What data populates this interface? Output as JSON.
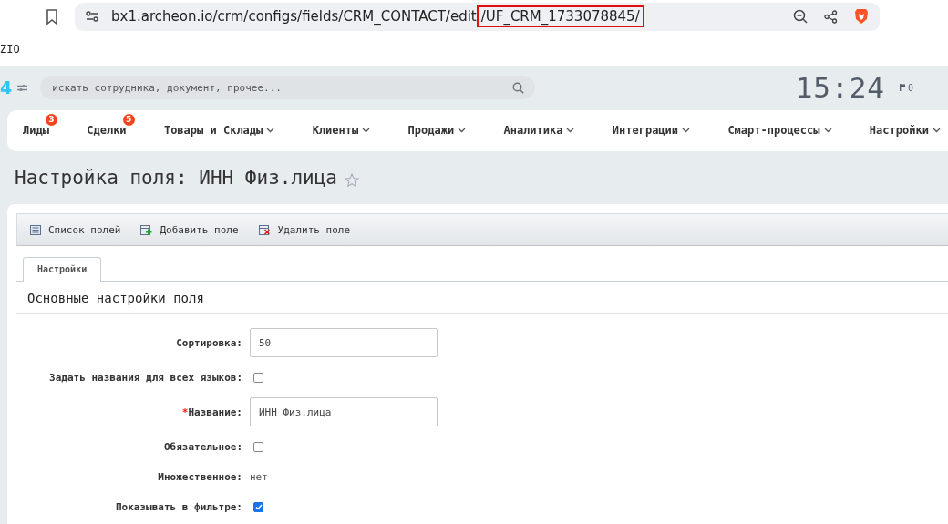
{
  "browser": {
    "url": "bx1.archeon.io/crm/configs/fields/CRM_CONTACT/edit",
    "url_highlight": "/UF_CRM_1733078845/"
  },
  "top_label": "ZIO",
  "header": {
    "logo_fragment": "4",
    "search": {
      "placeholder": "искать сотрудника, документ, прочее..."
    },
    "clock": "15:24",
    "flag_count": "0"
  },
  "nav": {
    "items": [
      {
        "label": "Лиды",
        "badge": "3",
        "dropdown": false
      },
      {
        "label": "Сделки",
        "badge": "5",
        "dropdown": false
      },
      {
        "label": "Товары и Склады",
        "dropdown": true
      },
      {
        "label": "Клиенты",
        "dropdown": true
      },
      {
        "label": "Продажи",
        "dropdown": true
      },
      {
        "label": "Аналитика",
        "dropdown": true
      },
      {
        "label": "Интеграции",
        "dropdown": true
      },
      {
        "label": "Смарт-процессы",
        "dropdown": true
      },
      {
        "label": "Настройки",
        "dropdown": true
      }
    ]
  },
  "title": "Настройка поля: ИНН Физ.лица",
  "toolbar": [
    {
      "label": "Список полей",
      "kind": "list"
    },
    {
      "label": "Добавить поле",
      "kind": "add"
    },
    {
      "label": "Удалить поле",
      "kind": "delete"
    }
  ],
  "tabs": [
    {
      "label": "Настройки",
      "selected": true
    }
  ],
  "section_title": "Основные настройки поля",
  "fields": [
    {
      "kind": "input",
      "label": "Сортировка:",
      "value": "50"
    },
    {
      "kind": "checkbox",
      "label": "Задать названия для всех языков:",
      "checked": false
    },
    {
      "kind": "input",
      "required_mark": "*",
      "label": "Название:",
      "value": "ИНН Физ.лица"
    },
    {
      "kind": "checkbox",
      "label": "Обязательное:",
      "checked": false
    },
    {
      "kind": "text",
      "label": "Множественное:",
      "value": "нет"
    },
    {
      "kind": "checkbox",
      "label": "Показывать в фильтре:",
      "checked": true
    }
  ]
}
